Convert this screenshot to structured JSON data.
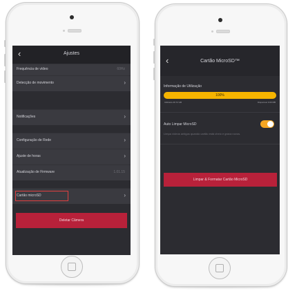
{
  "left_screen": {
    "nav_title": "Ajustes",
    "back_icon": "chevron-left-icon",
    "rows": [
      {
        "label": "Frequência de vídeo",
        "value": "60Hz"
      },
      {
        "label": "Detecção de movimento"
      },
      {
        "label": "Notificações"
      },
      {
        "label": "Configuração de Rede"
      },
      {
        "label": "Ajuste de horas"
      },
      {
        "label": "Atualização de Firmware",
        "value": "1.01.15"
      },
      {
        "label": "Cartão microSD"
      }
    ],
    "delete_label": "Deletar Câmera",
    "highlight_color": "#e14040",
    "accent": "#b8213a"
  },
  "right_screen": {
    "nav_title": "Cartão MicroSD™",
    "usage_title": "Informação de Utilização",
    "usage_percent": 1.0,
    "usage_percent_label": "100%",
    "used_label": "Utilizado 29.72 GB",
    "available_label": "Disponível 0.00 MB",
    "auto_clean_label": "Auto Limpar MicroSD",
    "auto_clean_on": true,
    "auto_clean_help": "Limpa vídeos antigos quando cartão está cheio e grava novos.",
    "format_label": "Limpar & Formatar Cartão MicroSD",
    "progress_color": "#f5b400",
    "toggle_color": "#f5a623",
    "accent": "#b8213a"
  }
}
